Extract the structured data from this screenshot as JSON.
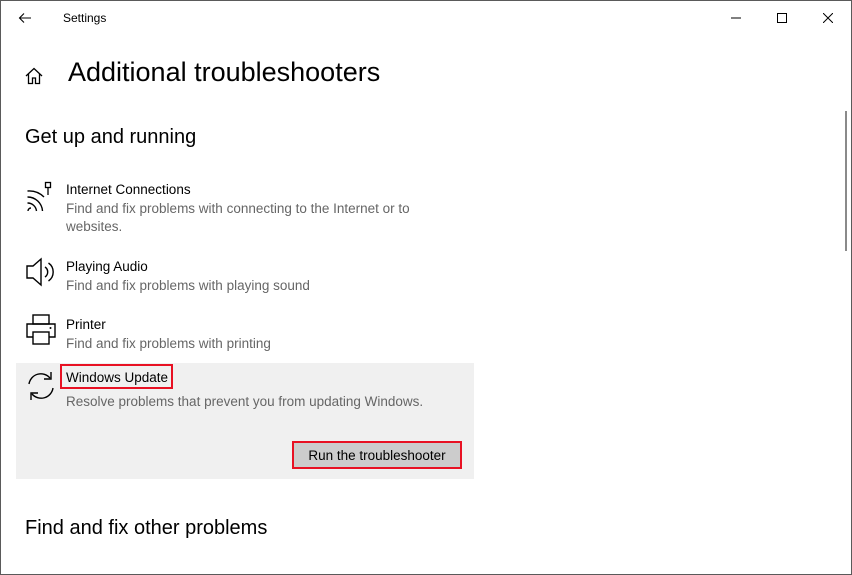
{
  "window": {
    "app_title": "Settings"
  },
  "page": {
    "title": "Additional troubleshooters"
  },
  "sections": {
    "get_up_running": "Get up and running",
    "find_fix_other": "Find and fix other problems"
  },
  "items": [
    {
      "name": "Internet Connections",
      "desc": "Find and fix problems with connecting to the Internet or to websites.",
      "icon": "wifi-network-icon"
    },
    {
      "name": "Playing Audio",
      "desc": "Find and fix problems with playing sound",
      "icon": "speaker-icon"
    },
    {
      "name": "Printer",
      "desc": "Find and fix problems with printing",
      "icon": "printer-icon"
    },
    {
      "name": "Windows Update",
      "desc": "Resolve problems that prevent you from updating Windows.",
      "icon": "sync-icon"
    }
  ],
  "actions": {
    "run_label": "Run the troubleshooter"
  },
  "colors": {
    "highlight": "#e81123",
    "selected_bg": "#f0f0f0",
    "button_bg": "#cccccc"
  }
}
